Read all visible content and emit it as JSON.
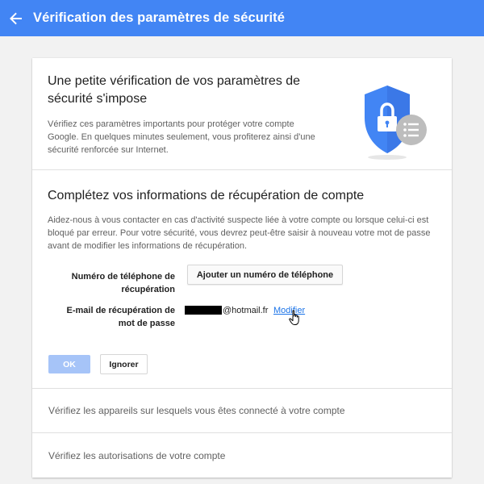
{
  "header": {
    "title": "Vérification des paramètres de sécurité",
    "back_icon": "arrow-left-icon",
    "color": "#4285f4"
  },
  "intro": {
    "heading": "Une petite vérification de vos paramètres de sécurité s'impose",
    "text": "Vérifiez ces paramètres importants pour protéger votre compte Google. En quelques minutes seulement, vous profiterez ainsi d'une sécurité renforcée sur Internet.",
    "icon": "shield-lock-checklist-icon"
  },
  "recovery": {
    "heading": "Complétez vos informations de récupération de compte",
    "text": "Aidez-nous à vous contacter en cas d'activité suspecte liée à votre compte ou lorsque celui-ci est bloqué par erreur. Pour votre sécurité, vous devrez peut-être saisir à nouveau votre mot de passe avant de modifier les informations de récupération.",
    "phone_label": "Numéro de téléphone de récupération",
    "add_phone_button": "Ajouter un numéro de téléphone",
    "email_label": "E-mail de récupération de mot de passe",
    "email_domain": "@hotmail.fr",
    "modify_link": "Modifier",
    "ok_button": "OK",
    "ignore_button": "Ignorer"
  },
  "rows": {
    "devices": "Vérifiez les appareils sur lesquels vous êtes connecté à votre compte",
    "permissions": "Vérifiez les autorisations de votre compte"
  }
}
